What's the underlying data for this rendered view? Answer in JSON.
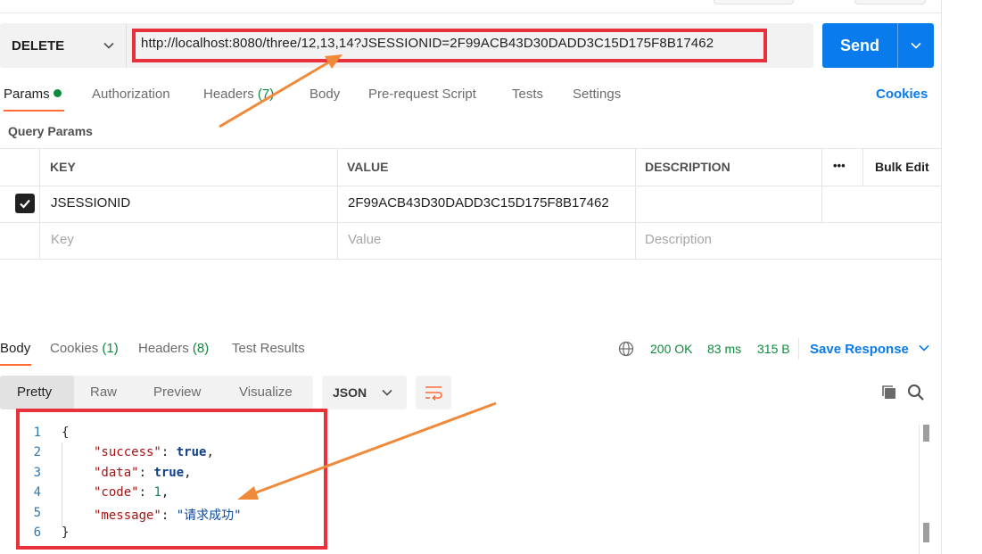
{
  "request": {
    "method": "DELETE",
    "url": "http://localhost:8080/three/12,13,14?JSESSIONID=2F99ACB43D30DADD3C15D175F8B17462",
    "send_label": "Send"
  },
  "request_tabs": [
    {
      "label": "Params",
      "active": true
    },
    {
      "label": "Authorization"
    },
    {
      "label": "Headers",
      "count": "(7)"
    },
    {
      "label": "Body"
    },
    {
      "label": "Pre-request Script"
    },
    {
      "label": "Tests"
    },
    {
      "label": "Settings"
    }
  ],
  "cookies_label": "Cookies",
  "query_params": {
    "title": "Query Params",
    "headers": {
      "key": "KEY",
      "value": "VALUE",
      "description": "DESCRIPTION",
      "more": "•••",
      "bulk_edit": "Bulk Edit"
    },
    "rows": [
      {
        "key": "JSESSIONID",
        "value": "2F99ACB43D30DADD3C15D175F8B17462",
        "description": "",
        "checked": true
      }
    ],
    "placeholders": {
      "key": "Key",
      "value": "Value",
      "description": "Description"
    }
  },
  "response_tabs": [
    {
      "label": "Body",
      "active": true
    },
    {
      "label": "Cookies",
      "count": "(1)"
    },
    {
      "label": "Headers",
      "count": "(8)"
    },
    {
      "label": "Test Results"
    }
  ],
  "response_status": {
    "status": "200 OK",
    "time": "83 ms",
    "size": "315 B"
  },
  "save_response_label": "Save Response",
  "format_tabs": [
    {
      "label": "Pretty",
      "active": true
    },
    {
      "label": "Raw"
    },
    {
      "label": "Preview"
    },
    {
      "label": "Visualize"
    }
  ],
  "format_select": "JSON",
  "response_body": {
    "line_numbers": [
      "1",
      "2",
      "3",
      "4",
      "5",
      "6"
    ],
    "open_brace": "{",
    "close_brace": "}",
    "fields": [
      {
        "key": "\"success\"",
        "value": "true",
        "type": "bool",
        "comma": ","
      },
      {
        "key": "\"data\"",
        "value": "true",
        "type": "bool",
        "comma": ","
      },
      {
        "key": "\"code\"",
        "value": "1",
        "type": "num",
        "comma": ","
      },
      {
        "key": "\"message\"",
        "value": "\"请求成功\"",
        "type": "str",
        "comma": ""
      }
    ]
  },
  "colors": {
    "accent": "#097bed",
    "tab_active": "#ff6c37",
    "success": "#0f8a3c",
    "annotation_red": "#e8313a",
    "annotation_arrow": "#f08a3a"
  }
}
